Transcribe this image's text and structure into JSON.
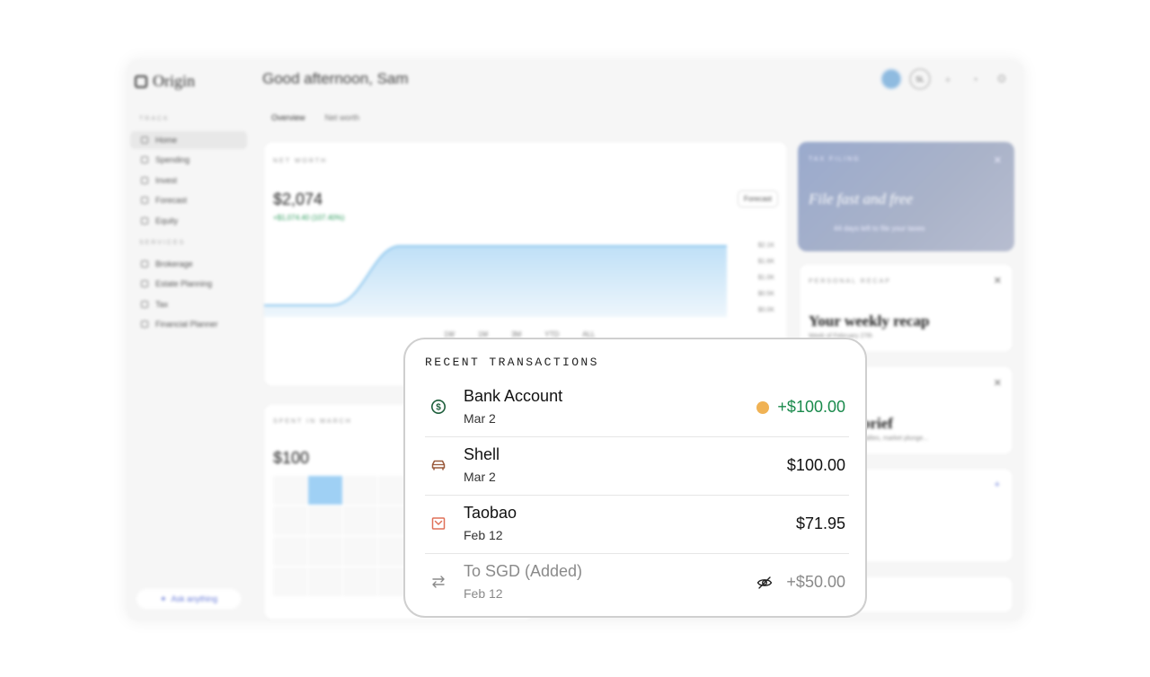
{
  "app": {
    "logo": "Origin",
    "greeting": "Good afternoon, Sam",
    "user_initials": "SL",
    "sidebar": {
      "section_track": "TRACK",
      "track_items": [
        "Home",
        "Spending",
        "Invest",
        "Forecast",
        "Equity"
      ],
      "section_services": "SERVICES",
      "service_items": [
        "Brokerage",
        "Estate Planning",
        "Tax",
        "Financial Planner"
      ],
      "ask_button": "Ask anything"
    },
    "tabs": [
      "Overview",
      "Net worth"
    ],
    "net_worth": {
      "label": "NET WORTH",
      "value": "$2,074",
      "change": "+$1,074.40 (107.40%)",
      "forecast_button": "Forecast",
      "y_ticks": [
        "$2.1K",
        "$1.6K",
        "$1.0K",
        "$0.5K",
        "$0.0K"
      ],
      "ranges": [
        "1W",
        "1M",
        "3M",
        "YTD",
        "ALL"
      ]
    },
    "spent": {
      "label": "SPENT IN MARCH",
      "value": "$100"
    },
    "tax_card": {
      "label": "TAX FILING",
      "title": "File fast and free",
      "days_left": "44 days left to file your taxes"
    },
    "recap_card": {
      "label": "PERSONAL RECAP",
      "title": "Your weekly recap",
      "subtitle": "Week of February 27th"
    },
    "brief_card": {
      "title": "Market brief",
      "subtitle": "Stocks rise as tech rallies, market plunge..."
    }
  },
  "transactions": {
    "title": "RECENT TRANSACTIONS",
    "items": [
      {
        "icon": "dollar-circle-icon",
        "name": "Bank Account",
        "date": "Mar 2",
        "amount": "+$100.00",
        "positive": true,
        "status": "pending-dot"
      },
      {
        "icon": "car-icon",
        "name": "Shell",
        "date": "Mar 2",
        "amount": "$100.00",
        "positive": false
      },
      {
        "icon": "shopping-bag-icon",
        "name": "Taobao",
        "date": "Feb 12",
        "amount": "$71.95",
        "positive": false
      },
      {
        "icon": "transfer-icon",
        "name": "To SGD (Added)",
        "date": "Feb 12",
        "amount": "+$50.00",
        "positive": true,
        "hidden": true
      }
    ]
  },
  "colors": {
    "positive": "#1a8a4c",
    "pending_dot": "#f0b254",
    "icon_green": "#1d5e3b",
    "icon_brown": "#9a5a3c",
    "icon_orange": "#e07058",
    "icon_grey": "#8a8a8a"
  }
}
